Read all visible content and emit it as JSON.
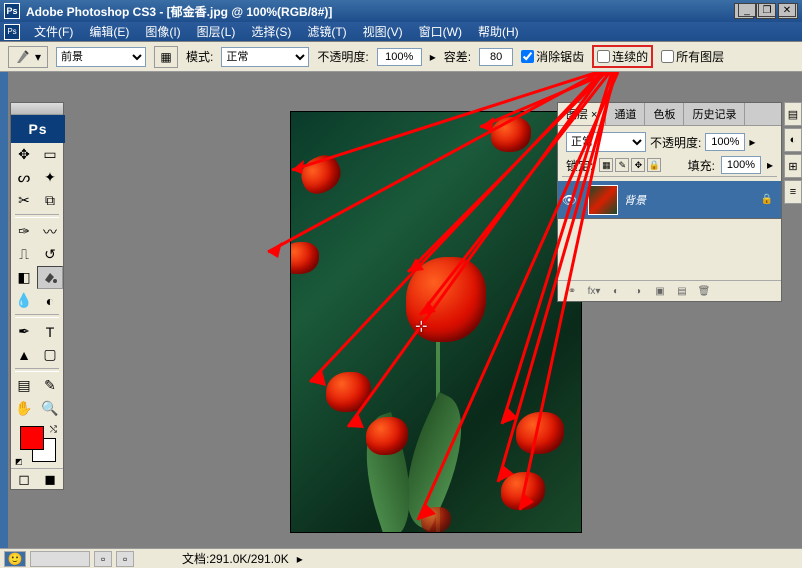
{
  "app": {
    "title": "Adobe Photoshop CS3 - [郁金香.jpg @ 100%(RGB/8#)]",
    "ps": "Ps"
  },
  "menu": [
    "文件(F)",
    "编辑(E)",
    "图像(I)",
    "图层(L)",
    "选择(S)",
    "滤镜(T)",
    "视图(V)",
    "窗口(W)",
    "帮助(H)"
  ],
  "options": {
    "foreground_label": "前景",
    "mode_label": "模式:",
    "mode_value": "正常",
    "opacity_label": "不透明度:",
    "opacity_value": "100%",
    "tolerance_label": "容差:",
    "tolerance_value": "80",
    "antialias": "消除锯齿",
    "contiguous": "连续的",
    "all_layers": "所有图层"
  },
  "colors": {
    "fg": "#ff0000",
    "bg": "#ffffff"
  },
  "layers_panel": {
    "tabs": [
      "图层 ×",
      "通道",
      "色板",
      "历史记录"
    ],
    "blend_mode": "正常",
    "opacity_label": "不透明度:",
    "opacity_value": "100%",
    "lock_label": "锁定:",
    "fill_label": "填充:",
    "fill_value": "100%",
    "layer_name": "背景"
  },
  "status": {
    "doc_size": "文档:291.0K/291.0K"
  }
}
